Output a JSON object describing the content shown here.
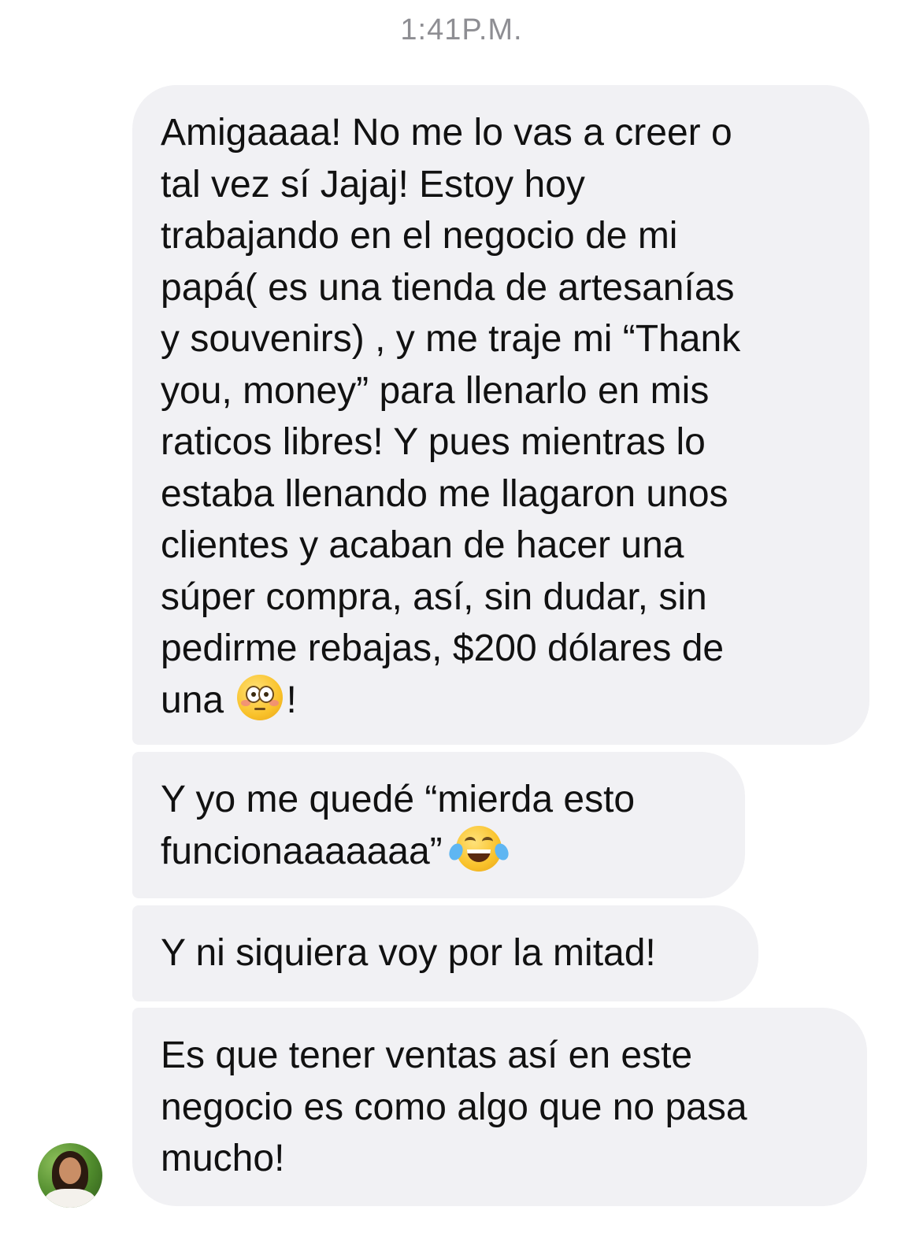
{
  "timestamp": "1:41P.M.",
  "messages": [
    {
      "text_before": "Amigaaaa! No me lo vas a creer o\ntal vez sí Jajaj! Estoy hoy\ntrabajando en el negocio de mi\npapá( es una tienda de artesanías\ny souvenirs) , y me traje mi “Thank\nyou, money” para llenarlo en mis\nraticos libres! Y pues mientras lo\nestaba llenando me llagaron unos\nclientes y acaban de hacer una\nsúper compra, así, sin dudar, sin\npedirme rebajas, $200 dólares de\nuna",
      "emoji": "flushed-face",
      "text_after": "!"
    },
    {
      "text_before": "Y yo me quedé “mierda esto\nfuncionaaaaaaa”",
      "emoji": "face-with-tears-of-joy",
      "text_after": ""
    },
    {
      "text_before": "Y ni siquiera voy por la mitad!"
    },
    {
      "text_before": "Es que tener ventas así en este\nnegocio es como algo que no pasa\nmucho!"
    }
  ],
  "sender_avatar": "contact-avatar",
  "colors": {
    "bubble_background": "#f1f1f4",
    "timestamp_text": "#8e8e93",
    "message_text": "#111111"
  }
}
